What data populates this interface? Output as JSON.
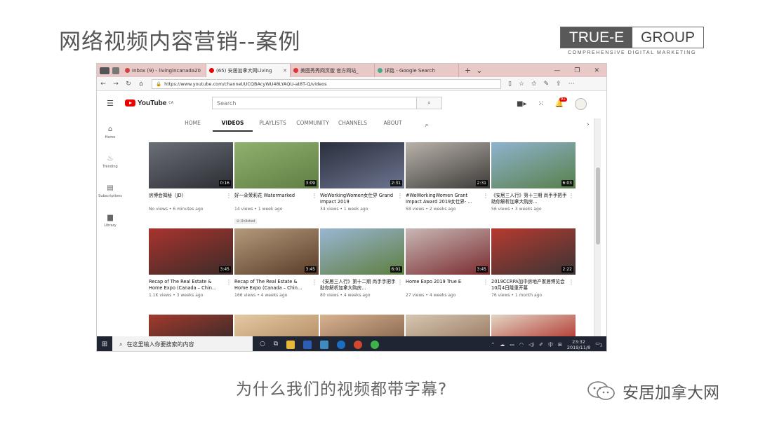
{
  "slide": {
    "title": "网络视频内容营销--案例",
    "question": "为什么我们的视频都带字幕?",
    "watermark": "安居加拿大网"
  },
  "logo": {
    "left": "TRUE-E",
    "right": "GROUP",
    "tagline": "COMPREHENSIVE DIGITAL MARKETING"
  },
  "browser": {
    "tabs": [
      {
        "label": "Inbox (9) - livingincanada20",
        "fav": "#c44"
      },
      {
        "label": "(65) 安居加拿大网Living",
        "fav": "#e00",
        "active": true
      },
      {
        "label": "美图秀秀网页版 官方网站_",
        "fav": "#d33"
      },
      {
        "label": "详路 - Google Search",
        "fav": "#4a8"
      }
    ],
    "url": "https://www.youtube.com/channel/UCQBAcyWU48LYAQU-at8T-Q/videos"
  },
  "youtube": {
    "logo_word": "YouTube",
    "logo_region": "CA",
    "search_placeholder": "Search",
    "notif_count": "9+",
    "leftnav": [
      {
        "icon": "home-icon",
        "glyph": "⌂",
        "label": "Home"
      },
      {
        "icon": "trending-icon",
        "glyph": "♨",
        "label": "Trending"
      },
      {
        "icon": "subscriptions-icon",
        "glyph": "▤",
        "label": "Subscriptions"
      },
      {
        "icon": "library-icon",
        "glyph": "▆",
        "label": "Library"
      }
    ],
    "channel_tabs": [
      "HOME",
      "VIDEOS",
      "PLAYLISTS",
      "COMMUNITY",
      "CHANNELS",
      "ABOUT"
    ],
    "videos_row1": [
      {
        "title": "房博会揭秘（JD）",
        "meta": "No views • 6 minutes ago",
        "dur": "0:16",
        "c1": "#6b6f76",
        "c2": "#2b2d33"
      },
      {
        "title": "好一朵茉莉花 Watermarked",
        "meta": "14 views • 1 week ago",
        "dur": "3:09",
        "c1": "#8fb06e",
        "c2": "#5f7f44",
        "badge": "Unlisted"
      },
      {
        "title": "WeWorkingWomen女仕界 Grand Impact 2019",
        "meta": "34 views • 1 week ago",
        "dur": "2:31",
        "c1": "#2a2f3d",
        "c2": "#6d7590"
      },
      {
        "title": "#WeWorkingWomen Grant Impact Award 2019女仕界- ...",
        "meta": "58 views • 2 weeks ago",
        "dur": "2:31",
        "c1": "#b9b2aa",
        "c2": "#3c3a38"
      },
      {
        "title": "《安居三人行》第十三期 尚手手把手助你解析加拿大购房...",
        "meta": "56 views • 3 weeks ago",
        "dur": "6:03",
        "c1": "#8fb3cf",
        "c2": "#58804a"
      }
    ],
    "videos_row2": [
      {
        "title": "Recap of The Real Estate & Home Expo (Canada – Chin...",
        "meta": "1.1K views • 3 weeks ago",
        "dur": "3:45",
        "c1": "#a9332e",
        "c2": "#3b2b28"
      },
      {
        "title": "Recap of The Real Estate & Home Expo (Canada – Chin...",
        "meta": "166 views • 4 weeks ago",
        "dur": "3:45",
        "c1": "#b49a7c",
        "c2": "#5a3c28"
      },
      {
        "title": "《安居三人行》第十二期 尚手手把手助你解析加拿大购房...",
        "meta": "80 views • 4 weeks ago",
        "dur": "6:01",
        "c1": "#9ab6d4",
        "c2": "#5d7e3f"
      },
      {
        "title": "Home Expo 2019 True E",
        "meta": "27 views • 4 weeks ago",
        "dur": "3:45",
        "c1": "#c8b8b6",
        "c2": "#7a2a2e"
      },
      {
        "title": "2019CCRPA加中房地产家居博览会10月4日隆重开幕",
        "meta": "76 views • 1 month ago",
        "dur": "2:22",
        "c1": "#b63a30",
        "c2": "#3a3434"
      }
    ],
    "videos_row3": [
      {
        "c1": "#a33a2c",
        "c2": "#3d2a2a"
      },
      {
        "c1": "#e4c9a2",
        "c2": "#b69069"
      },
      {
        "c1": "#d9b28f",
        "c2": "#8b6a52"
      },
      {
        "c1": "#d6c7b2",
        "c2": "#9c7d66"
      },
      {
        "c1": "#e3d6c5",
        "c2": "#b33a32"
      }
    ]
  },
  "taskbar": {
    "search_placeholder": "在这里输入你要搜索的内容",
    "ime1": "中",
    "time": "23:32",
    "date": "2019/11/8",
    "notif": "3"
  }
}
